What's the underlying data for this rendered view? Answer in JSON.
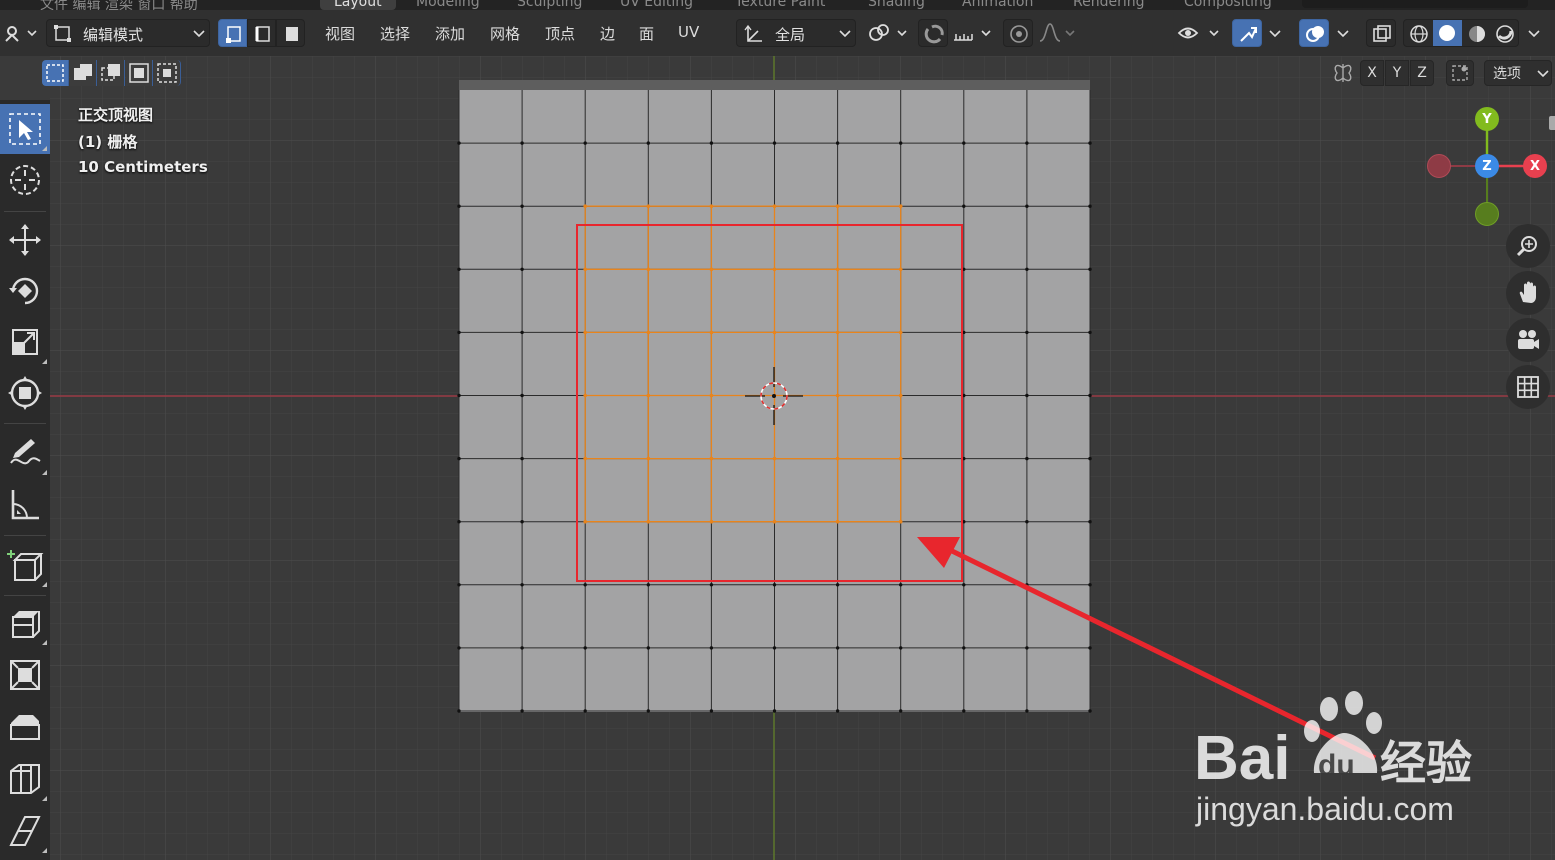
{
  "workspace_tabs": [
    "Layout",
    "Modeling",
    "Sculpting",
    "UV Editing",
    "Texture Paint",
    "Shading",
    "Animation",
    "Rendering",
    "Compositing"
  ],
  "header": {
    "mode_label": "编辑模式",
    "menus": [
      "视图",
      "选择",
      "添加",
      "网格",
      "顶点",
      "边",
      "面",
      "UV"
    ],
    "transform_orientation": "全局",
    "options_label": "选项"
  },
  "axis_toggles": [
    "X",
    "Y",
    "Z"
  ],
  "viewport": {
    "view_name": "正交顶视图",
    "object_name": "(1) 栅格",
    "grid_scale": "10 Centimeters"
  },
  "gizmo": {
    "x": "X",
    "y": "Y",
    "z": "Z"
  },
  "watermark": {
    "brand": "Bai du 经验",
    "url": "jingyan.baidu.com"
  },
  "colors": {
    "accent": "#4772b3",
    "annotation": "#e8262d",
    "selected_edge": "#e8841c",
    "x_axis": "#e8404f",
    "y_axis": "#82bb1e",
    "z_axis": "#3b8ae6"
  }
}
